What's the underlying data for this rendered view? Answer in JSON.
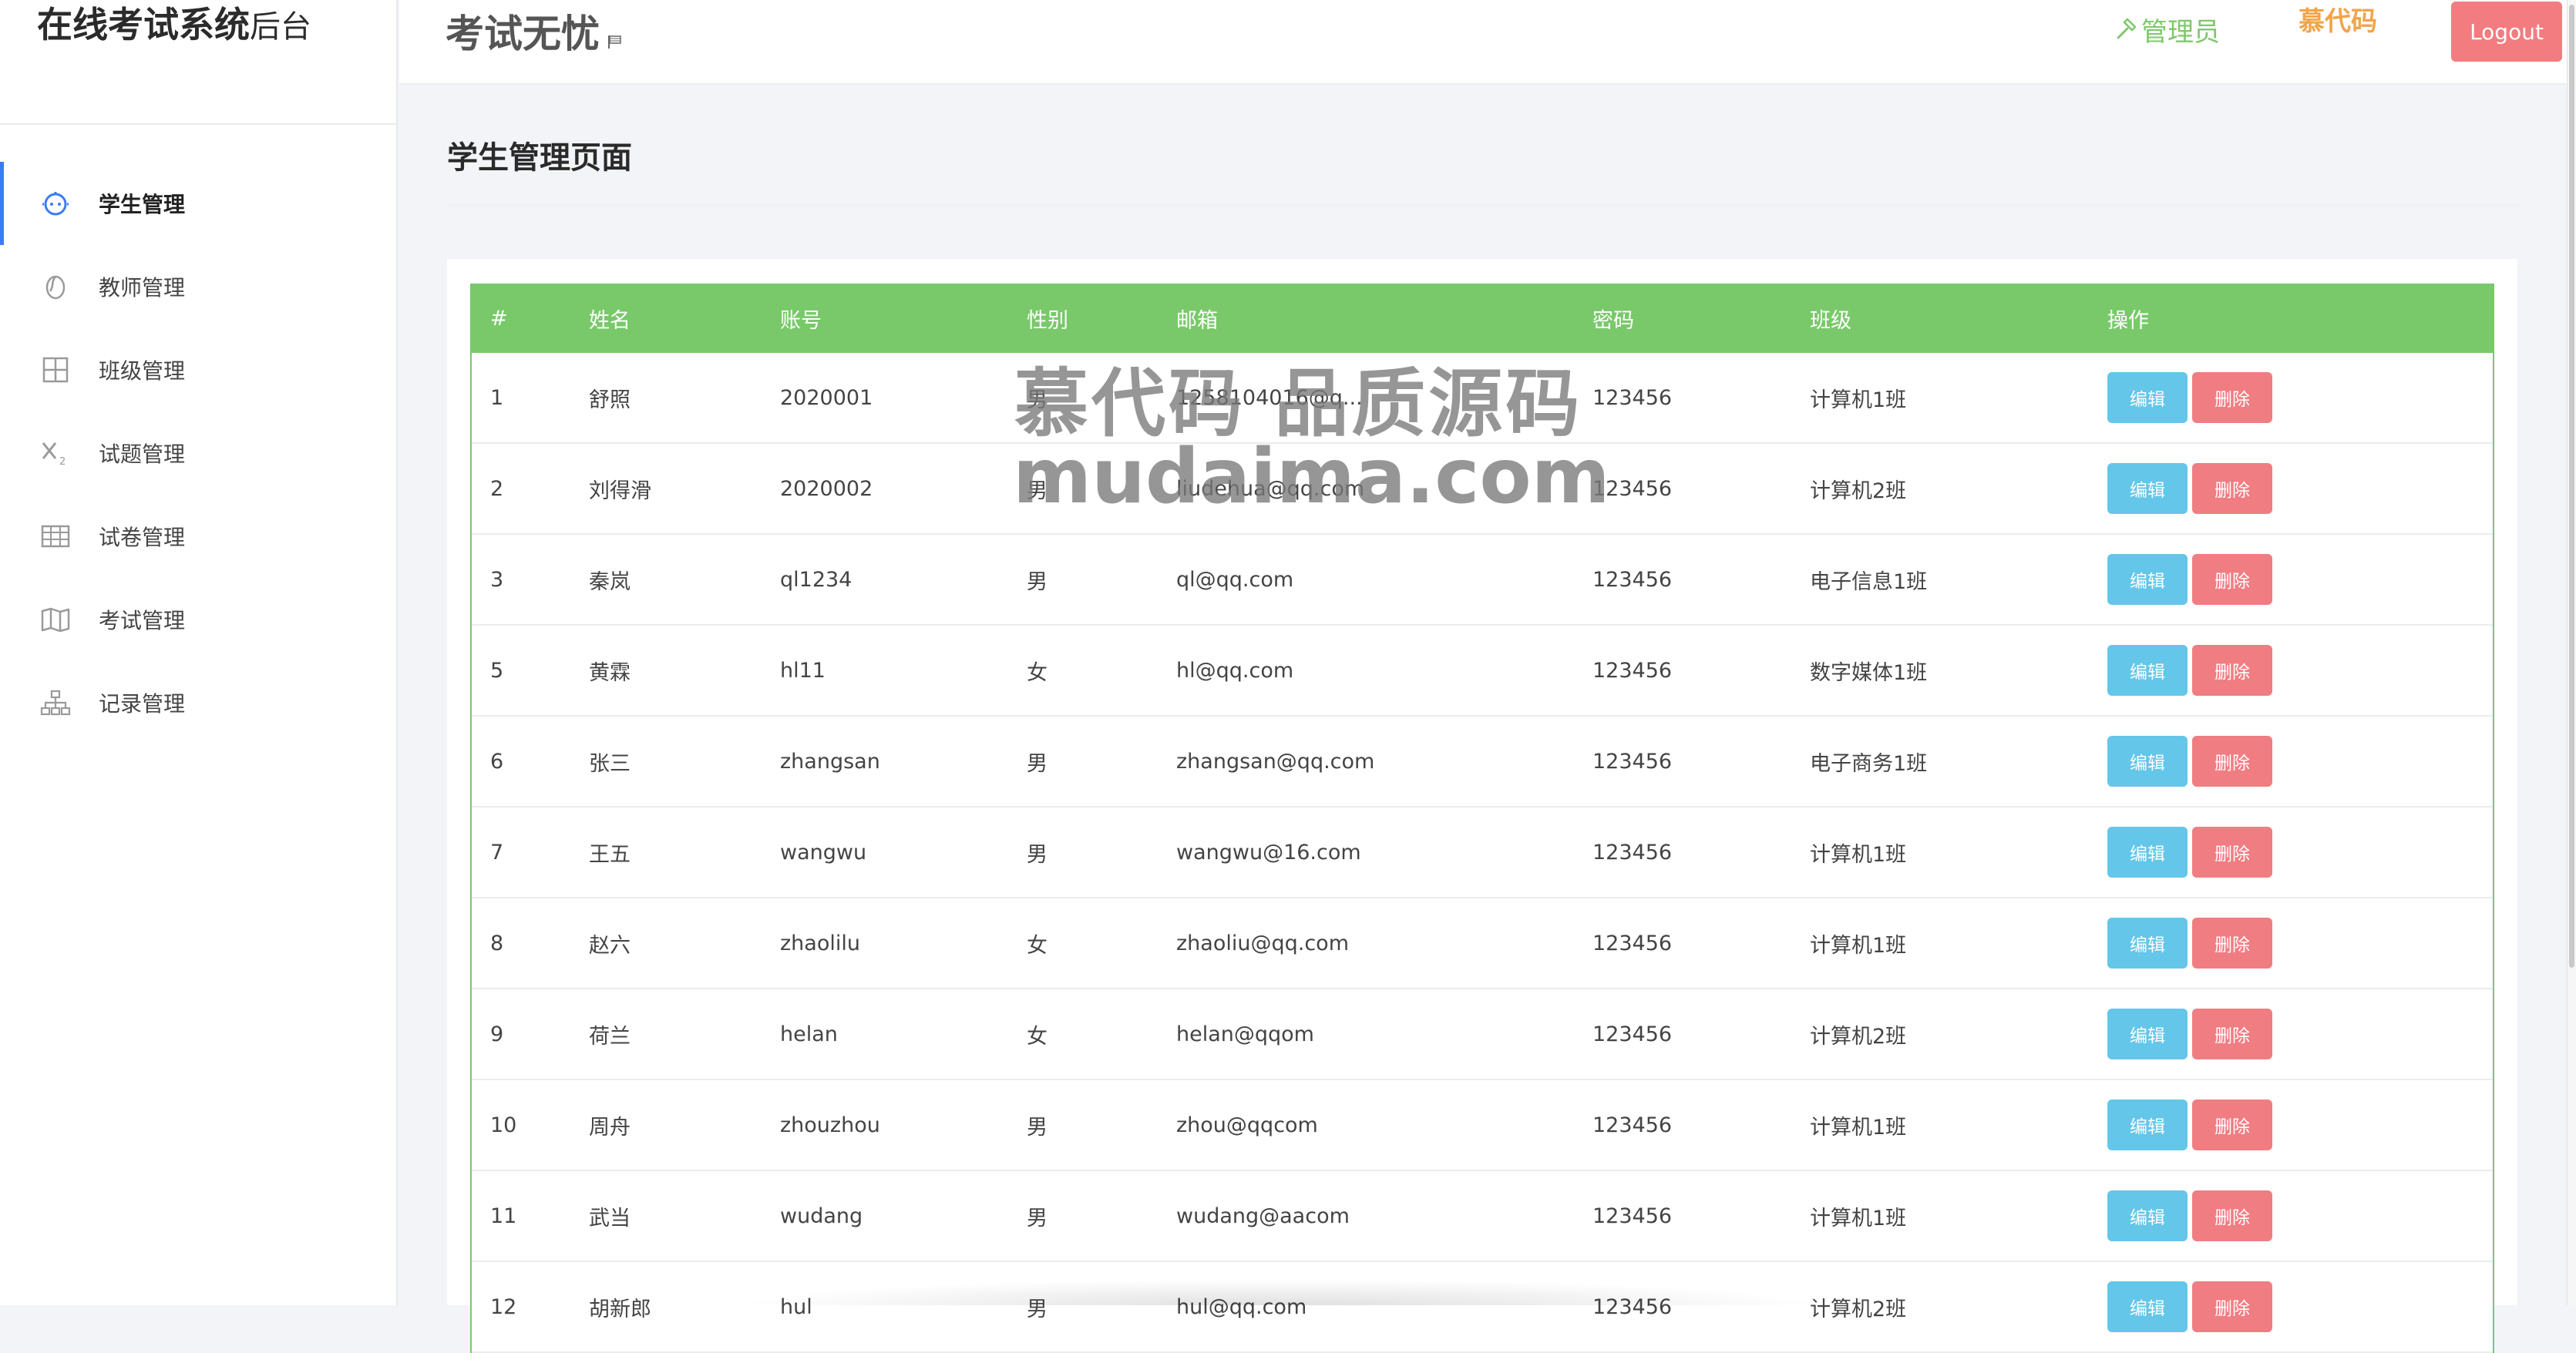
{
  "sidebar": {
    "brand_main": "在线考试系统",
    "brand_sub": "后台",
    "items": [
      {
        "label": "学生管理",
        "icon": "student-icon",
        "active": true
      },
      {
        "label": "教师管理",
        "icon": "teacher-icon",
        "active": false
      },
      {
        "label": "班级管理",
        "icon": "class-grid-icon",
        "active": false
      },
      {
        "label": "试题管理",
        "icon": "formula-icon",
        "active": false
      },
      {
        "label": "试卷管理",
        "icon": "table-icon",
        "active": false
      },
      {
        "label": "考试管理",
        "icon": "map-icon",
        "active": false
      },
      {
        "label": "记录管理",
        "icon": "sitemap-icon",
        "active": false
      }
    ]
  },
  "header": {
    "title": "考试无忧",
    "admin_label": "管理员",
    "site_brand": "慕代码",
    "logout_label": "Logout"
  },
  "main": {
    "page_title": "学生管理页面",
    "table": {
      "columns": [
        "#",
        "姓名",
        "账号",
        "性别",
        "邮箱",
        "密码",
        "班级",
        "操作"
      ],
      "edit_label": "编辑",
      "delete_label": "删除",
      "rows": [
        {
          "id": "1",
          "name": "舒照",
          "account": "2020001",
          "gender": "男",
          "email": "1258104016@q...",
          "password": "123456",
          "class": "计算机1班"
        },
        {
          "id": "2",
          "name": "刘得滑",
          "account": "2020002",
          "gender": "男",
          "email": "liudehua@qq.com",
          "password": "123456",
          "class": "计算机2班"
        },
        {
          "id": "3",
          "name": "秦岚",
          "account": "ql1234",
          "gender": "男",
          "email": "ql@qq.com",
          "password": "123456",
          "class": "电子信息1班"
        },
        {
          "id": "5",
          "name": "黄霖",
          "account": "hl11",
          "gender": "女",
          "email": "hl@qq.com",
          "password": "123456",
          "class": "数字媒体1班"
        },
        {
          "id": "6",
          "name": "张三",
          "account": "zhangsan",
          "gender": "男",
          "email": "zhangsan@qq.com",
          "password": "123456",
          "class": "电子商务1班"
        },
        {
          "id": "7",
          "name": "王五",
          "account": "wangwu",
          "gender": "男",
          "email": "wangwu@16.com",
          "password": "123456",
          "class": "计算机1班"
        },
        {
          "id": "8",
          "name": "赵六",
          "account": "zhaolilu",
          "gender": "女",
          "email": "zhaoliu@qq.com",
          "password": "123456",
          "class": "计算机1班"
        },
        {
          "id": "9",
          "name": "荷兰",
          "account": "helan",
          "gender": "女",
          "email": "helan@qqom",
          "password": "123456",
          "class": "计算机2班"
        },
        {
          "id": "10",
          "name": "周舟",
          "account": "zhouzhou",
          "gender": "男",
          "email": "zhou@qqcom",
          "password": "123456",
          "class": "计算机1班"
        },
        {
          "id": "11",
          "name": "武当",
          "account": "wudang",
          "gender": "男",
          "email": "wudang@aacom",
          "password": "123456",
          "class": "计算机1班"
        },
        {
          "id": "12",
          "name": "胡新郎",
          "account": "hul",
          "gender": "男",
          "email": "hul@qq.com",
          "password": "123456",
          "class": "计算机2班"
        }
      ]
    }
  },
  "watermark": {
    "line1": "慕代码 品质源码",
    "line2": "mudaima.com"
  },
  "colors": {
    "accent_green": "#79c96b",
    "edit_blue": "#64c6e9",
    "delete_red": "#f07d82",
    "logout_red": "#f37c80",
    "brand_orange": "#f0a54b",
    "active_blue": "#3b7cf6"
  }
}
